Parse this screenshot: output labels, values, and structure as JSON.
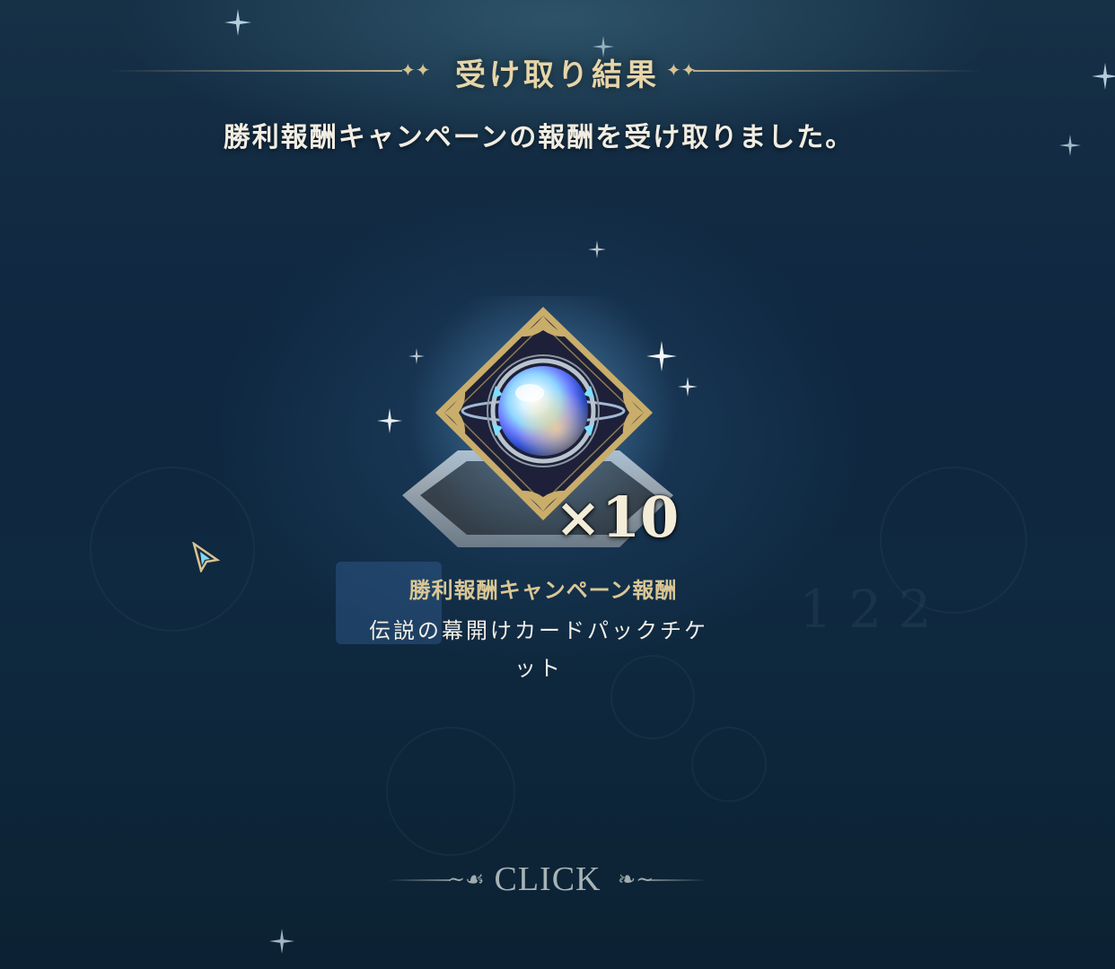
{
  "header": {
    "title": "受け取り結果",
    "message": "勝利報酬キャンペーンの報酬を受け取りました。"
  },
  "reward": {
    "quantity": "×10",
    "source_label": "勝利報酬キャンペーン報酬",
    "item_name": "伝説の幕開けカードパックチケット",
    "icon": "card-pack-ticket-orb-icon"
  },
  "footer": {
    "click_label": "CLICK"
  },
  "colors": {
    "gold": "#d8c392",
    "background": "#0f2740",
    "text": "#f2efe6"
  }
}
